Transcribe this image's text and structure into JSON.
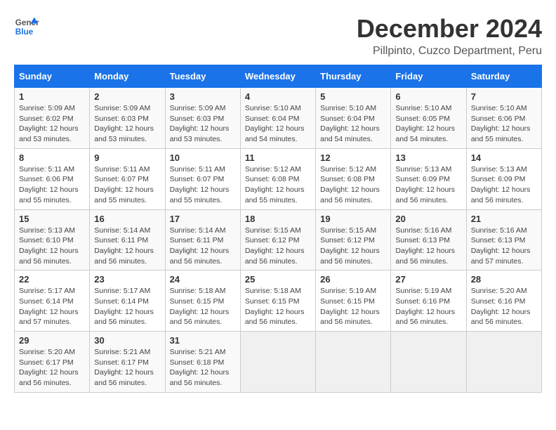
{
  "logo": {
    "line1": "General",
    "line2": "Blue"
  },
  "title": "December 2024",
  "subtitle": "Pillpinto, Cuzco Department, Peru",
  "weekdays": [
    "Sunday",
    "Monday",
    "Tuesday",
    "Wednesday",
    "Thursday",
    "Friday",
    "Saturday"
  ],
  "weeks": [
    [
      {
        "day": "1",
        "info": "Sunrise: 5:09 AM\nSunset: 6:02 PM\nDaylight: 12 hours\nand 53 minutes."
      },
      {
        "day": "2",
        "info": "Sunrise: 5:09 AM\nSunset: 6:03 PM\nDaylight: 12 hours\nand 53 minutes."
      },
      {
        "day": "3",
        "info": "Sunrise: 5:09 AM\nSunset: 6:03 PM\nDaylight: 12 hours\nand 53 minutes."
      },
      {
        "day": "4",
        "info": "Sunrise: 5:10 AM\nSunset: 6:04 PM\nDaylight: 12 hours\nand 54 minutes."
      },
      {
        "day": "5",
        "info": "Sunrise: 5:10 AM\nSunset: 6:04 PM\nDaylight: 12 hours\nand 54 minutes."
      },
      {
        "day": "6",
        "info": "Sunrise: 5:10 AM\nSunset: 6:05 PM\nDaylight: 12 hours\nand 54 minutes."
      },
      {
        "day": "7",
        "info": "Sunrise: 5:10 AM\nSunset: 6:06 PM\nDaylight: 12 hours\nand 55 minutes."
      }
    ],
    [
      {
        "day": "8",
        "info": "Sunrise: 5:11 AM\nSunset: 6:06 PM\nDaylight: 12 hours\nand 55 minutes."
      },
      {
        "day": "9",
        "info": "Sunrise: 5:11 AM\nSunset: 6:07 PM\nDaylight: 12 hours\nand 55 minutes."
      },
      {
        "day": "10",
        "info": "Sunrise: 5:11 AM\nSunset: 6:07 PM\nDaylight: 12 hours\nand 55 minutes."
      },
      {
        "day": "11",
        "info": "Sunrise: 5:12 AM\nSunset: 6:08 PM\nDaylight: 12 hours\nand 55 minutes."
      },
      {
        "day": "12",
        "info": "Sunrise: 5:12 AM\nSunset: 6:08 PM\nDaylight: 12 hours\nand 56 minutes."
      },
      {
        "day": "13",
        "info": "Sunrise: 5:13 AM\nSunset: 6:09 PM\nDaylight: 12 hours\nand 56 minutes."
      },
      {
        "day": "14",
        "info": "Sunrise: 5:13 AM\nSunset: 6:09 PM\nDaylight: 12 hours\nand 56 minutes."
      }
    ],
    [
      {
        "day": "15",
        "info": "Sunrise: 5:13 AM\nSunset: 6:10 PM\nDaylight: 12 hours\nand 56 minutes."
      },
      {
        "day": "16",
        "info": "Sunrise: 5:14 AM\nSunset: 6:11 PM\nDaylight: 12 hours\nand 56 minutes."
      },
      {
        "day": "17",
        "info": "Sunrise: 5:14 AM\nSunset: 6:11 PM\nDaylight: 12 hours\nand 56 minutes."
      },
      {
        "day": "18",
        "info": "Sunrise: 5:15 AM\nSunset: 6:12 PM\nDaylight: 12 hours\nand 56 minutes."
      },
      {
        "day": "19",
        "info": "Sunrise: 5:15 AM\nSunset: 6:12 PM\nDaylight: 12 hours\nand 56 minutes."
      },
      {
        "day": "20",
        "info": "Sunrise: 5:16 AM\nSunset: 6:13 PM\nDaylight: 12 hours\nand 56 minutes."
      },
      {
        "day": "21",
        "info": "Sunrise: 5:16 AM\nSunset: 6:13 PM\nDaylight: 12 hours\nand 57 minutes."
      }
    ],
    [
      {
        "day": "22",
        "info": "Sunrise: 5:17 AM\nSunset: 6:14 PM\nDaylight: 12 hours\nand 57 minutes."
      },
      {
        "day": "23",
        "info": "Sunrise: 5:17 AM\nSunset: 6:14 PM\nDaylight: 12 hours\nand 56 minutes."
      },
      {
        "day": "24",
        "info": "Sunrise: 5:18 AM\nSunset: 6:15 PM\nDaylight: 12 hours\nand 56 minutes."
      },
      {
        "day": "25",
        "info": "Sunrise: 5:18 AM\nSunset: 6:15 PM\nDaylight: 12 hours\nand 56 minutes."
      },
      {
        "day": "26",
        "info": "Sunrise: 5:19 AM\nSunset: 6:15 PM\nDaylight: 12 hours\nand 56 minutes."
      },
      {
        "day": "27",
        "info": "Sunrise: 5:19 AM\nSunset: 6:16 PM\nDaylight: 12 hours\nand 56 minutes."
      },
      {
        "day": "28",
        "info": "Sunrise: 5:20 AM\nSunset: 6:16 PM\nDaylight: 12 hours\nand 56 minutes."
      }
    ],
    [
      {
        "day": "29",
        "info": "Sunrise: 5:20 AM\nSunset: 6:17 PM\nDaylight: 12 hours\nand 56 minutes."
      },
      {
        "day": "30",
        "info": "Sunrise: 5:21 AM\nSunset: 6:17 PM\nDaylight: 12 hours\nand 56 minutes."
      },
      {
        "day": "31",
        "info": "Sunrise: 5:21 AM\nSunset: 6:18 PM\nDaylight: 12 hours\nand 56 minutes."
      },
      {
        "day": "",
        "info": ""
      },
      {
        "day": "",
        "info": ""
      },
      {
        "day": "",
        "info": ""
      },
      {
        "day": "",
        "info": ""
      }
    ]
  ]
}
